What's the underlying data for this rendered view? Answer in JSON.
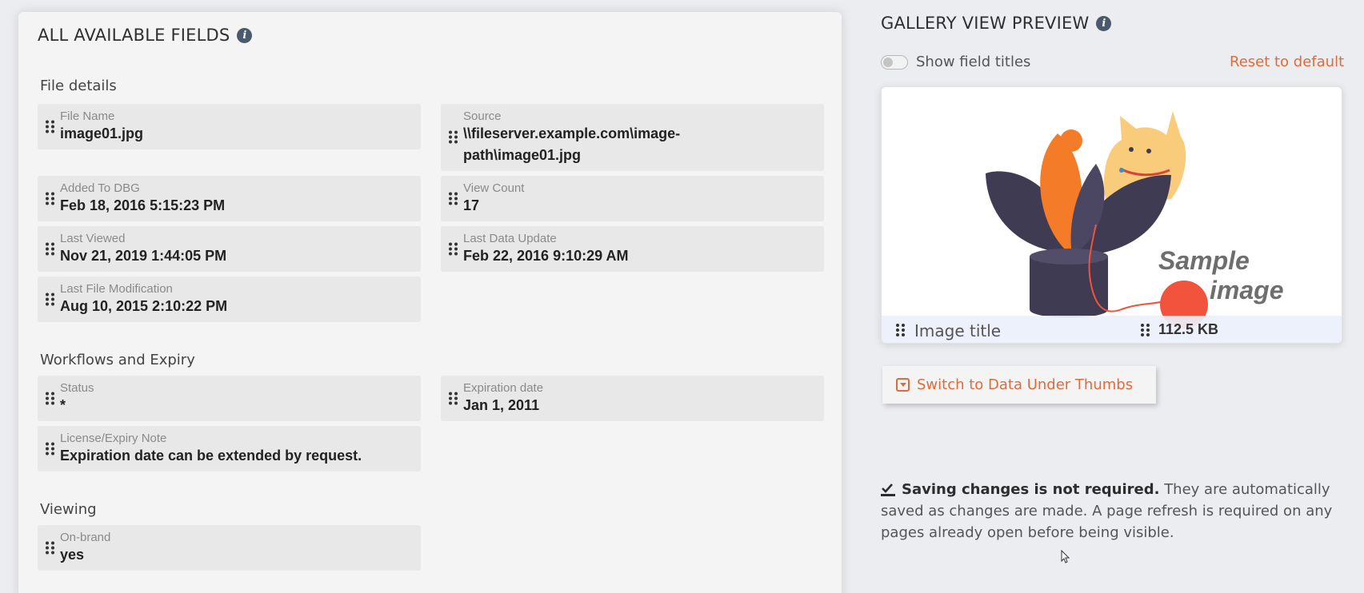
{
  "left_panel": {
    "title": "ALL AVAILABLE FIELDS",
    "sections": [
      {
        "title": "File details",
        "fields": [
          {
            "label": "File Name",
            "value": "image01.jpg"
          },
          {
            "label": "Source",
            "value": "\\\\fileserver.example.com\\image-path\\image01.jpg"
          },
          {
            "label": "Added To DBG",
            "value": "Feb 18, 2016 5:15:23 PM"
          },
          {
            "label": "View Count",
            "value": "17"
          },
          {
            "label": "Last Viewed",
            "value": "Nov 21, 2019 1:44:05 PM"
          },
          {
            "label": "Last Data Update",
            "value": "Feb 22, 2016 9:10:29 AM"
          },
          {
            "label": "Last File Modification",
            "value": "Aug 10, 2015 2:10:22 PM"
          }
        ]
      },
      {
        "title": "Workflows and Expiry",
        "fields": [
          {
            "label": "Status",
            "value": "*"
          },
          {
            "label": "Expiration date",
            "value": "Jan 1, 2011"
          },
          {
            "label": "License/Expiry Note",
            "value": "Expiration date can be extended by request."
          }
        ]
      },
      {
        "title": "Viewing",
        "fields": [
          {
            "label": "On-brand",
            "value": "yes"
          }
        ]
      }
    ]
  },
  "right_panel": {
    "title": "GALLERY VIEW PREVIEW",
    "toggle": {
      "label": "Show field titles",
      "on": false
    },
    "reset_label": "Reset to default",
    "preview": {
      "watermark_line1": "Sample",
      "watermark_line2": "image",
      "title_field": "Image title",
      "size_field": "112.5 KB"
    },
    "switch_button_label": "Switch to Data Under Thumbs",
    "note": {
      "bold": "Saving changes is not required.",
      "text": " They are automatically saved as changes are made. A page refresh is required on any pages already open before being visible."
    }
  },
  "colors": {
    "accent": "#e06b3a",
    "panel_bg": "#f4f4f4",
    "field_bg": "#e8e8e8",
    "art_dark": "#3e3b53",
    "art_orange": "#f47b28",
    "art_cat": "#f9cc7b",
    "art_red": "#f2533c"
  }
}
